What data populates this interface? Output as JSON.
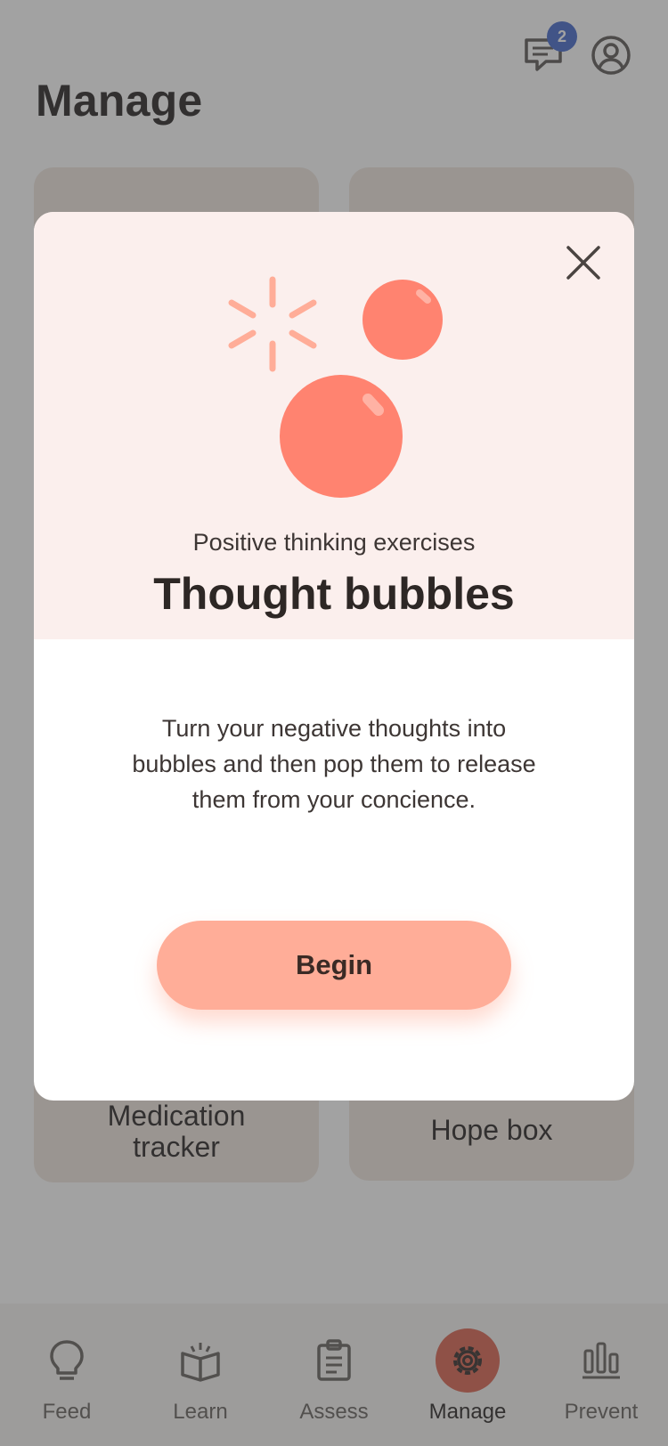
{
  "header": {
    "title": "Manage",
    "messages_badge": "2"
  },
  "cards": [
    {
      "label": "Medication\ntracker"
    },
    {
      "label": "Hope box"
    }
  ],
  "modal": {
    "subtitle": "Positive thinking exercises",
    "title": "Thought bubbles",
    "description": "Turn your negative thoughts into bubbles and then pop them to release them from your concience.",
    "button_label": "Begin"
  },
  "nav": [
    {
      "label": "Feed",
      "icon": "lightbulb-icon"
    },
    {
      "label": "Learn",
      "icon": "book-icon"
    },
    {
      "label": "Assess",
      "icon": "clipboard-icon"
    },
    {
      "label": "Manage",
      "icon": "gear-icon",
      "active": true
    },
    {
      "label": "Prevent",
      "icon": "bar-chart-icon"
    }
  ],
  "colors": {
    "accent": "#d85d48",
    "bubble": "#ff8370",
    "button": "#ffad98",
    "badge": "#3c63c9"
  }
}
